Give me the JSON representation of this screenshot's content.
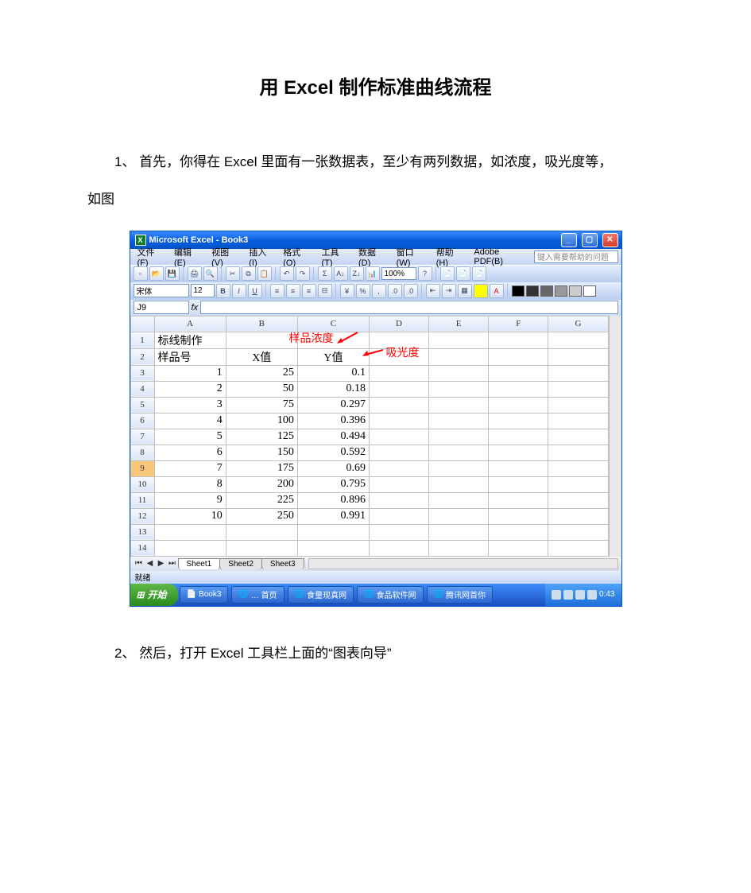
{
  "document": {
    "title": "用 Excel 制作标准曲线流程",
    "step1": "1、  首先，你得在 Excel 里面有一张数据表，至少有两列数据，如浓度，吸光度等，",
    "step1_cont": "如图",
    "step2": "2、  然后，打开 Excel 工具栏上面的“图表向导”"
  },
  "excel": {
    "window_title": "Microsoft Excel - Book3",
    "menus": [
      "文件(F)",
      "编辑(E)",
      "视图(V)",
      "插入(I)",
      "格式(O)",
      "工具(T)",
      "数据(D)",
      "窗口(W)",
      "帮助(H)",
      "Adobe PDF(B)"
    ],
    "ask_placeholder": "键入需要帮助的问题",
    "font_name": "宋体",
    "font_size": "12",
    "zoom": "100%",
    "namebox": "J9",
    "col_headers": [
      "A",
      "B",
      "C",
      "D",
      "E",
      "F",
      "G"
    ],
    "rows": {
      "1": {
        "A": "标线制作"
      },
      "2": {
        "A": "样品号",
        "B": "X值",
        "C": "Y值"
      },
      "3": {
        "A": "1",
        "B": "25",
        "C": "0.1"
      },
      "4": {
        "A": "2",
        "B": "50",
        "C": "0.18"
      },
      "5": {
        "A": "3",
        "B": "75",
        "C": "0.297"
      },
      "6": {
        "A": "4",
        "B": "100",
        "C": "0.396"
      },
      "7": {
        "A": "5",
        "B": "125",
        "C": "0.494"
      },
      "8": {
        "A": "6",
        "B": "150",
        "C": "0.592"
      },
      "9": {
        "A": "7",
        "B": "175",
        "C": "0.69"
      },
      "10": {
        "A": "8",
        "B": "200",
        "C": "0.795"
      },
      "11": {
        "A": "9",
        "B": "225",
        "C": "0.896"
      },
      "12": {
        "A": "10",
        "B": "250",
        "C": "0.991"
      }
    },
    "row_numbers": [
      "1",
      "2",
      "3",
      "4",
      "5",
      "6",
      "7",
      "8",
      "9",
      "10",
      "11",
      "12",
      "13",
      "14"
    ],
    "selected_row": "9",
    "sheets": [
      "Sheet1",
      "Sheet2",
      "Sheet3"
    ],
    "status": "就绪",
    "annotation_x": "样品浓度",
    "annotation_y": "吸光度"
  },
  "taskbar": {
    "start": "开始",
    "items": [
      "Book3",
      "… 首页",
      "食量现真网",
      "食品软件网",
      "腾讯网首你"
    ],
    "clock": "0:43"
  },
  "chart_data": {
    "type": "table",
    "title": "标线制作",
    "columns": [
      "样品号",
      "X值 (样品浓度)",
      "Y值 (吸光度)"
    ],
    "rows": [
      [
        1,
        25,
        0.1
      ],
      [
        2,
        50,
        0.18
      ],
      [
        3,
        75,
        0.297
      ],
      [
        4,
        100,
        0.396
      ],
      [
        5,
        125,
        0.494
      ],
      [
        6,
        150,
        0.592
      ],
      [
        7,
        175,
        0.69
      ],
      [
        8,
        200,
        0.795
      ],
      [
        9,
        225,
        0.896
      ],
      [
        10,
        250,
        0.991
      ]
    ]
  }
}
